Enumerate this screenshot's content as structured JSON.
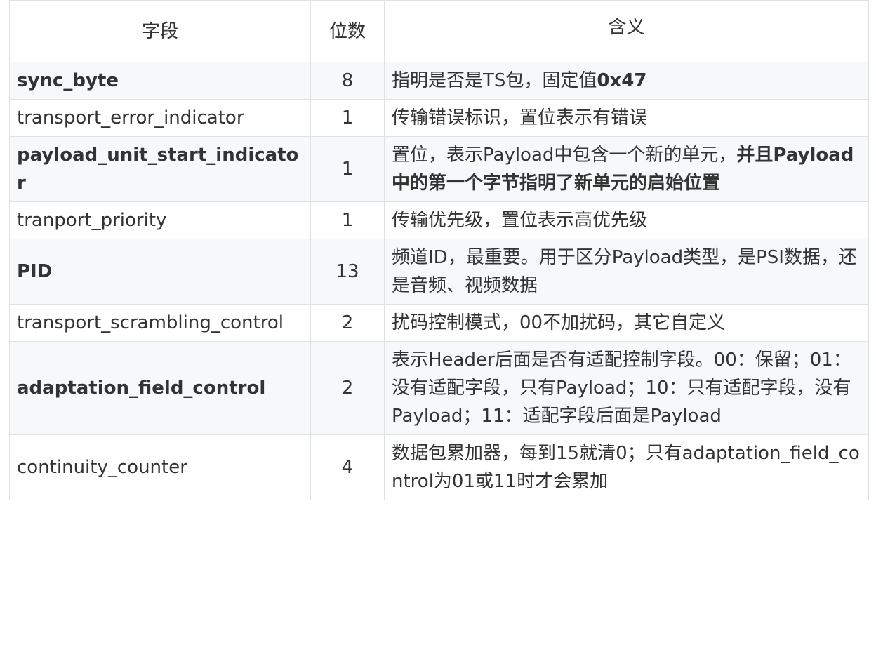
{
  "headers": [
    "字段",
    "位数",
    "含义"
  ],
  "rows": [
    {
      "field": "sync_byte",
      "field_bold": true,
      "bits": "8",
      "desc_parts": [
        {
          "text": "指明是否是TS包，固定值",
          "bold": false
        },
        {
          "text": "0x47",
          "bold": true
        }
      ]
    },
    {
      "field": "transport_error_indicator",
      "field_bold": false,
      "bits": "1",
      "desc_parts": [
        {
          "text": "传输错误标识，置位表示有错误",
          "bold": false
        }
      ]
    },
    {
      "field": "payload_unit_start_indicator",
      "field_bold": true,
      "bits": "1",
      "desc_parts": [
        {
          "text": "置位，表示Payload中包含一个新的单元，",
          "bold": false
        },
        {
          "text": "并且Payload中的第一个字节指明了新单元的启始位置",
          "bold": true
        }
      ]
    },
    {
      "field": "tranport_priority",
      "field_bold": false,
      "bits": "1",
      "desc_parts": [
        {
          "text": "传输优先级，置位表示高优先级",
          "bold": false
        }
      ]
    },
    {
      "field": "PID",
      "field_bold": true,
      "bits": "13",
      "desc_parts": [
        {
          "text": "频道ID，最重要。用于区分Payload类型，是PSI数据，还是音频、视频数据",
          "bold": false
        }
      ]
    },
    {
      "field": "transport_scrambling_control",
      "field_bold": false,
      "bits": "2",
      "desc_parts": [
        {
          "text": "扰码控制模式，00不加扰码，其它自定义",
          "bold": false
        }
      ]
    },
    {
      "field": "adaptation_field_control",
      "field_bold": true,
      "bits": "2",
      "desc_parts": [
        {
          "text": "表示Header后面是否有适配控制字段。00：保留；01：没有适配字段，只有Payload；10：只有适配字段，没有Payload；11：适配字段后面是Payload",
          "bold": false
        }
      ]
    },
    {
      "field": "continuity_counter",
      "field_bold": false,
      "bits": "4",
      "desc_parts": [
        {
          "text": "数据包累加器，每到15就清0；只有adaptation_field_control为01或11时才会累加",
          "bold": false
        }
      ]
    }
  ]
}
